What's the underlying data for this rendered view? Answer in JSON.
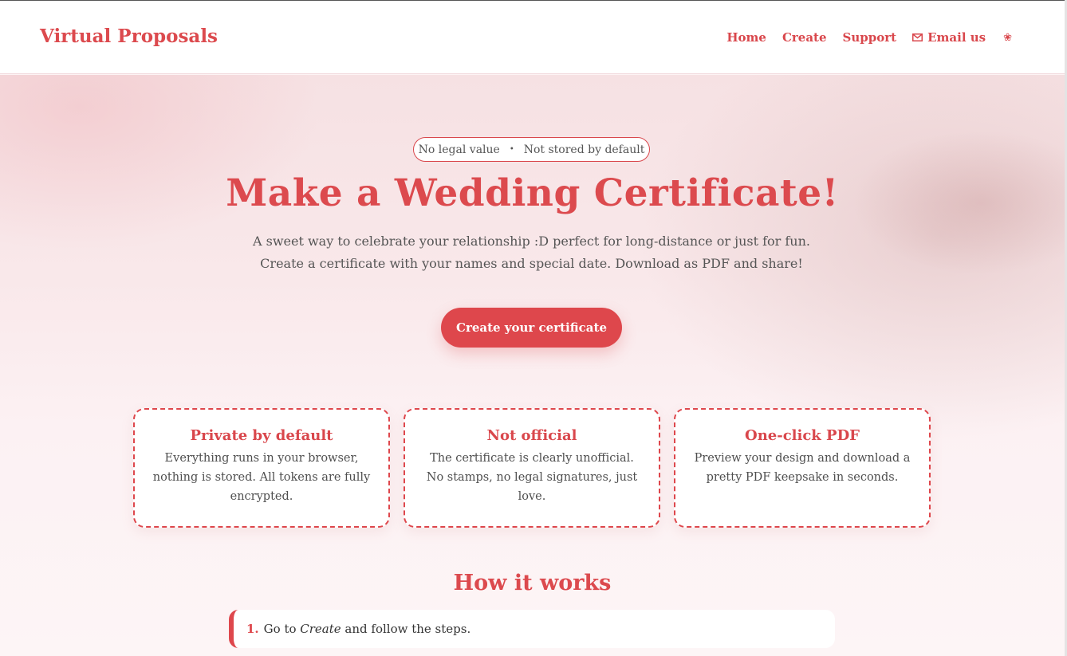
{
  "brand": "Virtual Proposals",
  "nav": {
    "home": "Home",
    "create": "Create",
    "support": "Support",
    "email": "Email us",
    "email_icon": "mail-icon",
    "flower_icon": "flower-icon",
    "flower_glyph": "❀"
  },
  "hero": {
    "pill_left": "No legal value",
    "pill_sep": "•",
    "pill_right": "Not stored by default",
    "title": "Make a Wedding Certificate!",
    "lead": "A sweet way to celebrate your relationship :D perfect for long-distance or just for fun. Create a certificate with your names and special date. Download as PDF and share!",
    "cta": "Create your certificate"
  },
  "features": [
    {
      "title": "Private by default",
      "text": "Everything runs in your browser, nothing is stored. All tokens are fully encrypted."
    },
    {
      "title": "Not official",
      "text": "The certificate is clearly unofficial. No stamps, no legal signatures, just love."
    },
    {
      "title": "One-click PDF",
      "text": "Preview your design and download a pretty PDF keepsake in seconds."
    }
  ],
  "how": {
    "title": "How it works",
    "steps": [
      {
        "num": "1.",
        "pre": "Go to ",
        "em": "Create",
        "post": " and follow the steps."
      }
    ]
  },
  "colors": {
    "accent": "#de474c",
    "text": "#4a4a4a"
  }
}
